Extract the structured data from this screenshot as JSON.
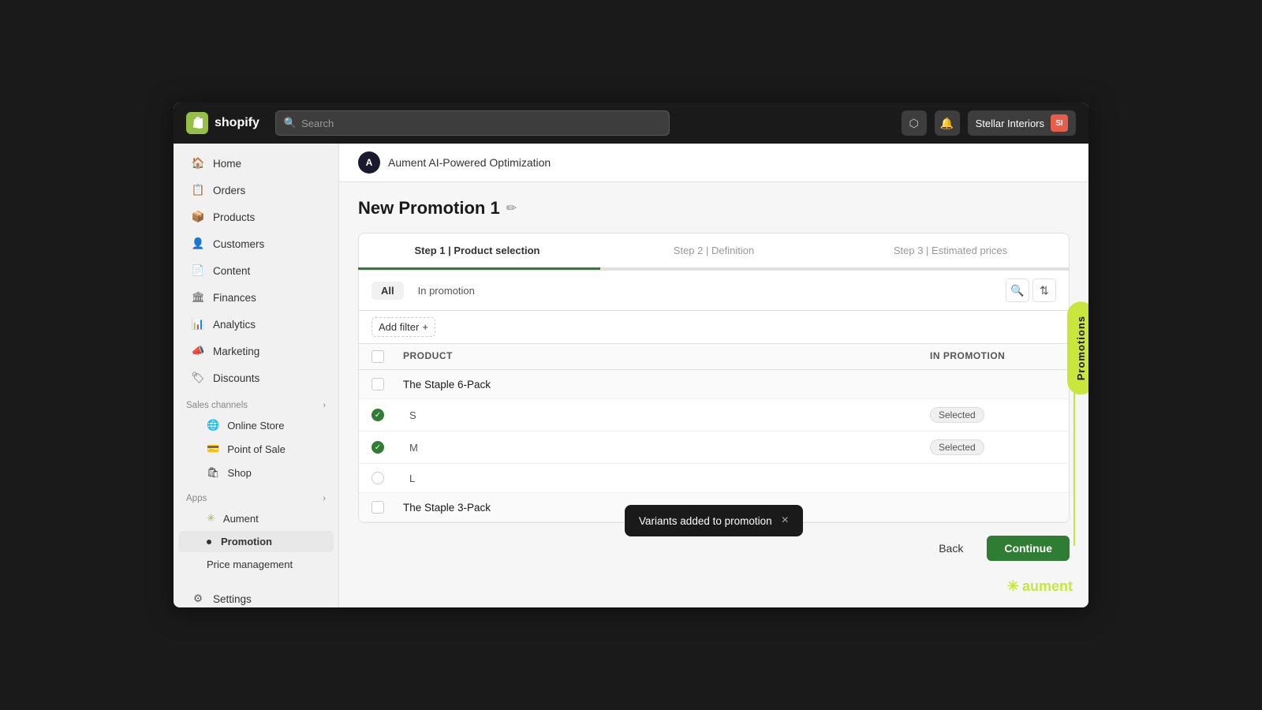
{
  "topbar": {
    "logo_text": "shopify",
    "search_placeholder": "Search",
    "store_name": "Stellar Interiors",
    "store_initials": "SI"
  },
  "sidebar": {
    "nav_items": [
      {
        "id": "home",
        "label": "Home",
        "icon": "🏠"
      },
      {
        "id": "orders",
        "label": "Orders",
        "icon": "📋"
      },
      {
        "id": "products",
        "label": "Products",
        "icon": "📦"
      },
      {
        "id": "customers",
        "label": "Customers",
        "icon": "👤"
      },
      {
        "id": "content",
        "label": "Content",
        "icon": "📄"
      },
      {
        "id": "finances",
        "label": "Finances",
        "icon": "🏛"
      },
      {
        "id": "analytics",
        "label": "Analytics",
        "icon": "📊"
      },
      {
        "id": "marketing",
        "label": "Marketing",
        "icon": "📣"
      },
      {
        "id": "discounts",
        "label": "Discounts",
        "icon": "🏷"
      }
    ],
    "sales_channels_label": "Sales channels",
    "sales_channels": [
      {
        "id": "online-store",
        "label": "Online Store",
        "icon": "🌐"
      },
      {
        "id": "pos",
        "label": "Point of Sale",
        "icon": "💳"
      },
      {
        "id": "shop",
        "label": "Shop",
        "icon": "🛍"
      }
    ],
    "apps_label": "Apps",
    "apps": [
      {
        "id": "aument",
        "label": "Aument",
        "icon": "⚙"
      },
      {
        "id": "promotion",
        "label": "Promotion",
        "active": true
      },
      {
        "id": "price-management",
        "label": "Price management"
      }
    ],
    "settings_label": "Settings"
  },
  "app_header": {
    "app_name": "Aument AI-Powered Optimization"
  },
  "page": {
    "title": "New Promotion 1",
    "steps": [
      {
        "id": "step1",
        "label": "Step 1 | Product selection",
        "active": true
      },
      {
        "id": "step2",
        "label": "Step 2 | Definition"
      },
      {
        "id": "step3",
        "label": "Step 3 | Estimated prices"
      }
    ],
    "tabs": {
      "all_label": "All",
      "in_promotion_label": "In promotion"
    },
    "filter_btn": "Add filter",
    "table": {
      "col_product": "Product",
      "col_in_promotion": "In promotion",
      "rows": [
        {
          "id": "staple6",
          "type": "product",
          "name": "The Staple 6-Pack",
          "in_promotion": ""
        },
        {
          "id": "s",
          "type": "variant",
          "name": "S",
          "in_promotion": "Selected",
          "selected": true
        },
        {
          "id": "m",
          "type": "variant",
          "name": "M",
          "in_promotion": "Selected",
          "selected": true
        },
        {
          "id": "l",
          "type": "variant",
          "name": "L",
          "in_promotion": "",
          "selected": false
        },
        {
          "id": "staple3",
          "type": "product",
          "name": "The Staple 3-Pack",
          "in_promotion": ""
        }
      ]
    },
    "back_btn": "Back",
    "continue_btn": "Continue"
  },
  "toast": {
    "message": "Variants added to promotion",
    "close_label": "×"
  },
  "promo_side_tab": {
    "label": "Promotions"
  },
  "aument_logo": {
    "text": "aument"
  }
}
